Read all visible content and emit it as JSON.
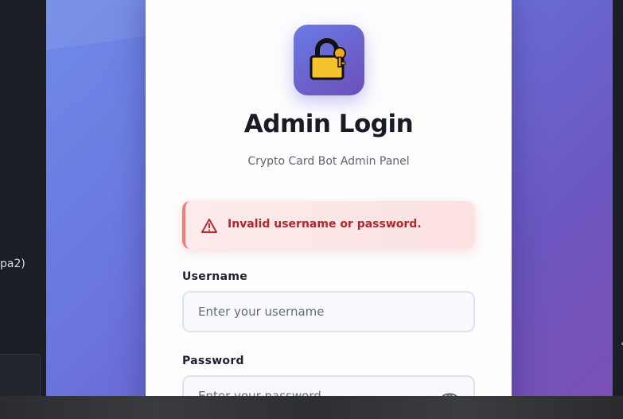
{
  "background": {
    "left_fragment": "pa2)",
    "right_tick": "‹"
  },
  "login": {
    "logo_icon": "lock-key-icon",
    "title": "Admin Login",
    "subtitle": "Crypto Card Bot Admin Panel",
    "alert": {
      "icon": "warning-triangle-icon",
      "message": "Invalid username or password.",
      "color": "#b3262b"
    },
    "username": {
      "label": "Username",
      "placeholder": "Enter your username",
      "value": ""
    },
    "password": {
      "label": "Password",
      "placeholder": "Enter your password",
      "value": "",
      "toggle_icon": "eye-icon"
    }
  },
  "colors": {
    "accent_start": "#6f8be8",
    "accent_end": "#7a4fb5",
    "error": "#b3262b"
  }
}
